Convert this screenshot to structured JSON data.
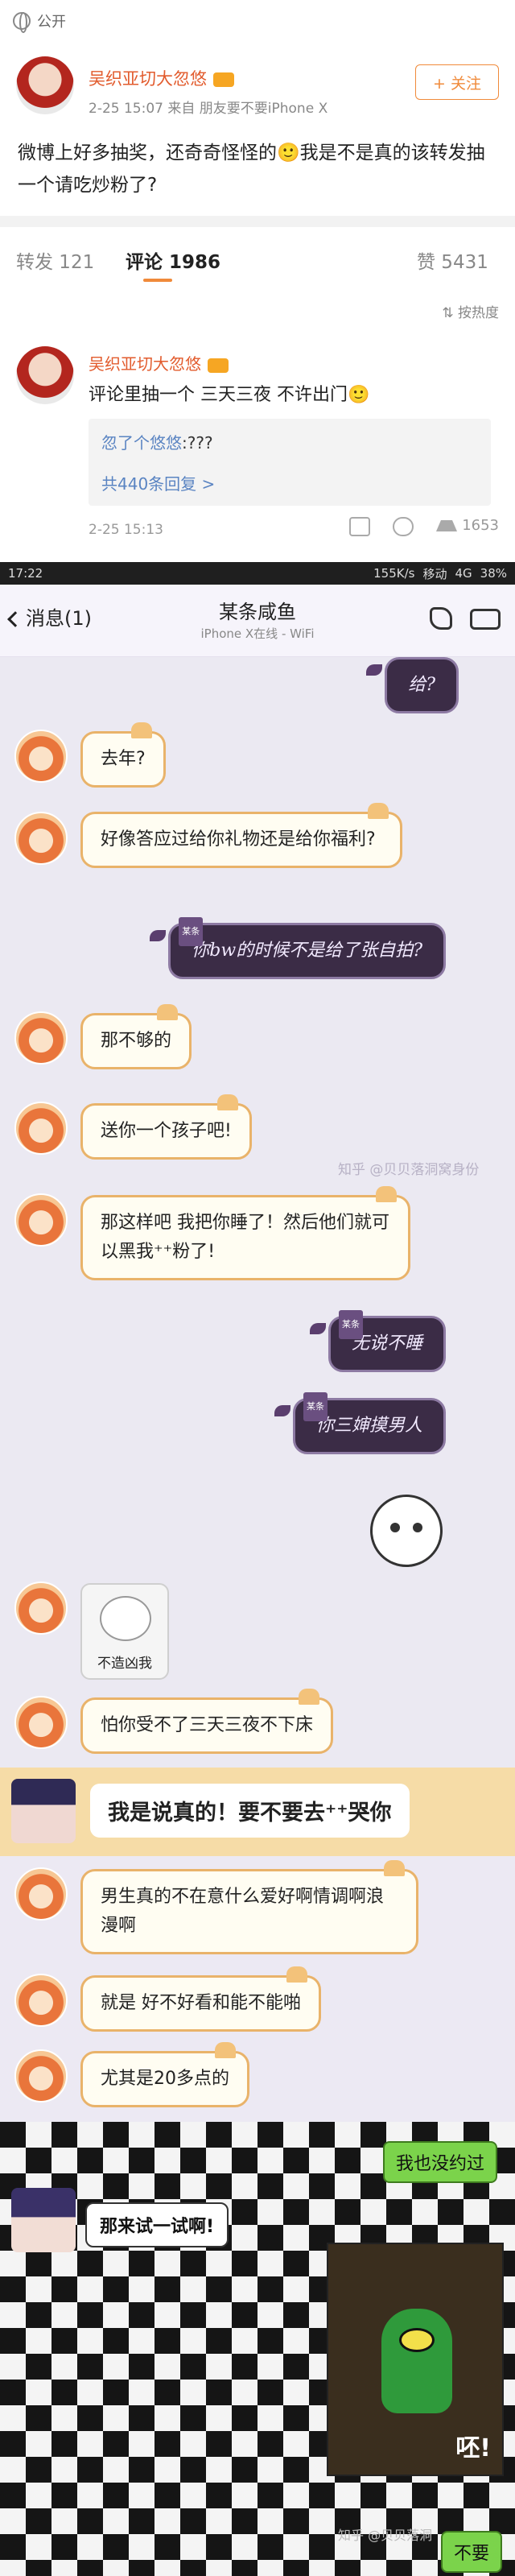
{
  "weibo": {
    "visibility": "公开",
    "author": "吴织亚切大忽悠",
    "meta": "2-25 15:07  来自 朋友要不要iPhone X",
    "follow_label": "+ 关注",
    "post_text": "微博上好多抽奖，还奇奇怪怪的🙂我是不是真的该转发抽一个请吃炒粉了?",
    "tabs": [
      {
        "label": "转发 121"
      },
      {
        "label": "评论 1986"
      },
      {
        "label": "赞 5431"
      }
    ],
    "sort_label": "按热度",
    "comment": {
      "author": "吴织亚切大忽悠",
      "text": "评论里抽一个 三天三夜 不许出门🙂",
      "reply_name": "忽了个悠悠",
      "reply_text": ":???",
      "reply_more": "共440条回复 >",
      "time": "2-25 15:13",
      "like_count": "1653"
    }
  },
  "statusbar": {
    "time": "17:22",
    "speed": "155K/s",
    "carrier": "移动",
    "network": "4G",
    "battery": "38%"
  },
  "chat": {
    "back_label": "消息(1)",
    "title": "某条咸鱼",
    "subtitle": "iPhone X在线 - WiFi",
    "messages": [
      {
        "side": "right",
        "text": "给?"
      },
      {
        "side": "left",
        "text": "去年?"
      },
      {
        "side": "left",
        "text": "好像答应过给你礼物还是给你福利?"
      },
      {
        "side": "right",
        "text": "你bw的时候不是给了张自拍?"
      },
      {
        "side": "left",
        "text": "那不够的"
      },
      {
        "side": "left",
        "text": "送你一个孩子吧!"
      },
      {
        "side": "left",
        "text": "那这样吧 我把你睡了！然后他们就可以黑我⁺⁺粉了!"
      },
      {
        "side": "right",
        "text": "无说不睡"
      },
      {
        "side": "right",
        "text": "你三婶摸男人"
      },
      {
        "side": "left",
        "text": "怕你受不了三天三夜不下床"
      }
    ],
    "sticker_caption": "不造凶我",
    "sticker_tag": "某条",
    "watermark": "知乎 @贝贝落洞窝身份"
  },
  "chat2": {
    "big_message": "我是说真的！要不要去⁺⁺哭你",
    "messages": [
      {
        "text": "男生真的不在意什么爱好啊情调啊浪漫啊"
      },
      {
        "text": "就是 好不好看和能不能啪"
      },
      {
        "text": "尤其是20多点的"
      }
    ]
  },
  "chat3": {
    "green_top": "我也没约过",
    "white_message": "那来试一试啊!",
    "plankton_text": "呸!",
    "green_bottom": "不要",
    "watermark": "知乎 @贝贝落洞"
  }
}
